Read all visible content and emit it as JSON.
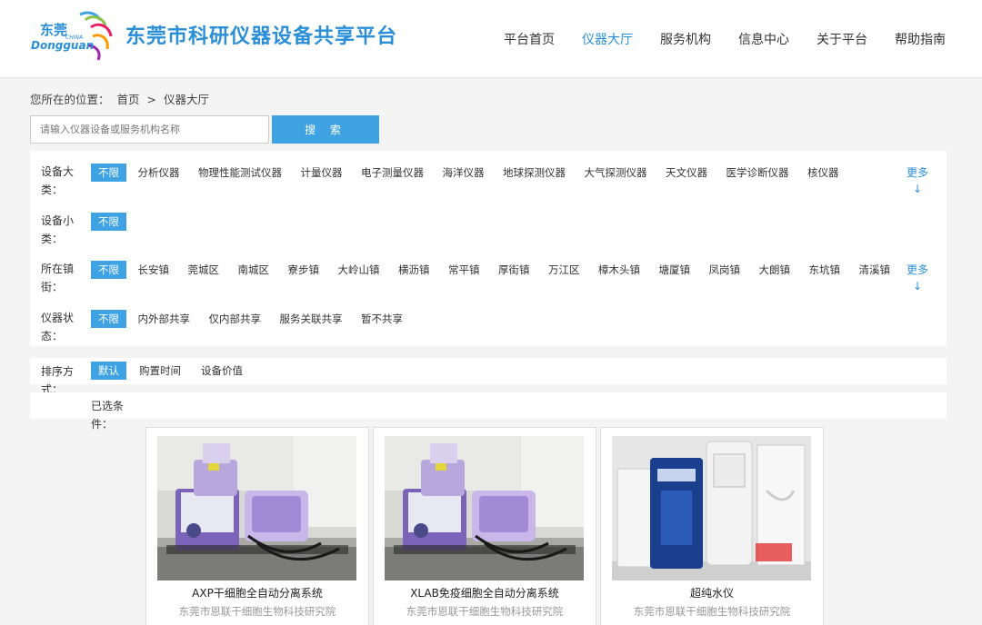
{
  "header": {
    "logo_text": "东莞",
    "logo_sub": "Dongguan",
    "logo_china": "CHINA",
    "site_title": "东莞市科研仪器设备共享平台",
    "nav": [
      {
        "label": "平台首页",
        "active": false
      },
      {
        "label": "仪器大厅",
        "active": true
      },
      {
        "label": "服务机构",
        "active": false
      },
      {
        "label": "信息中心",
        "active": false
      },
      {
        "label": "关于平台",
        "active": false
      },
      {
        "label": "帮助指南",
        "active": false
      }
    ]
  },
  "breadcrumb": {
    "prefix": "您所在的位置：",
    "home": "首页",
    "separator": ">",
    "current": "仪器大厅"
  },
  "search": {
    "placeholder": "请输入仪器设备或服务机构名称",
    "value": "",
    "button_label": "搜 索"
  },
  "filters": [
    {
      "label": "设备大类：",
      "options": [
        "不限",
        "分析仪器",
        "物理性能测试仪器",
        "计量仪器",
        "电子测量仪器",
        "海洋仪器",
        "地球探测仪器",
        "大气探测仪器",
        "天文仪器",
        "医学诊断仪器",
        "核仪器"
      ],
      "active": 0,
      "more": "更多",
      "more_icon": "↓"
    },
    {
      "label": "设备小类：",
      "options": [
        "不限"
      ],
      "active": 0
    },
    {
      "label": "所在镇街：",
      "options": [
        "不限",
        "长安镇",
        "莞城区",
        "南城区",
        "寮步镇",
        "大岭山镇",
        "横沥镇",
        "常平镇",
        "厚街镇",
        "万江区",
        "樟木头镇",
        "塘厦镇",
        "凤岗镇",
        "大朗镇",
        "东坑镇",
        "清溪镇"
      ],
      "active": 0,
      "more": "更多",
      "more_icon": "↓"
    },
    {
      "label": "仪器状态：",
      "options": [
        "不限",
        "内外部共享",
        "仅内部共享",
        "服务关联共享",
        "暂不共享"
      ],
      "active": 0
    }
  ],
  "sort": {
    "label": "排序方式：",
    "options": [
      "默认",
      "购置时间",
      "设备价值"
    ],
    "active": 0
  },
  "selected": {
    "label": "已选条件："
  },
  "cards": [
    {
      "title": "AXP干细胞全自动分离系统",
      "org": "东莞市恩联干细胞生物科技研究院",
      "image": "purple-cell-separator-photo"
    },
    {
      "title": "XLAB免疫细胞全自动分离系统",
      "org": "东莞市恩联干细胞生物科技研究院",
      "image": "purple-cell-separator-photo"
    },
    {
      "title": "超纯水仪",
      "org": "东莞市恩联干细胞生物科技研究院",
      "image": "milli-q-water-purifier-photo"
    }
  ],
  "colors": {
    "accent": "#3ea2e3",
    "title_blue": "#2a8fd6"
  }
}
